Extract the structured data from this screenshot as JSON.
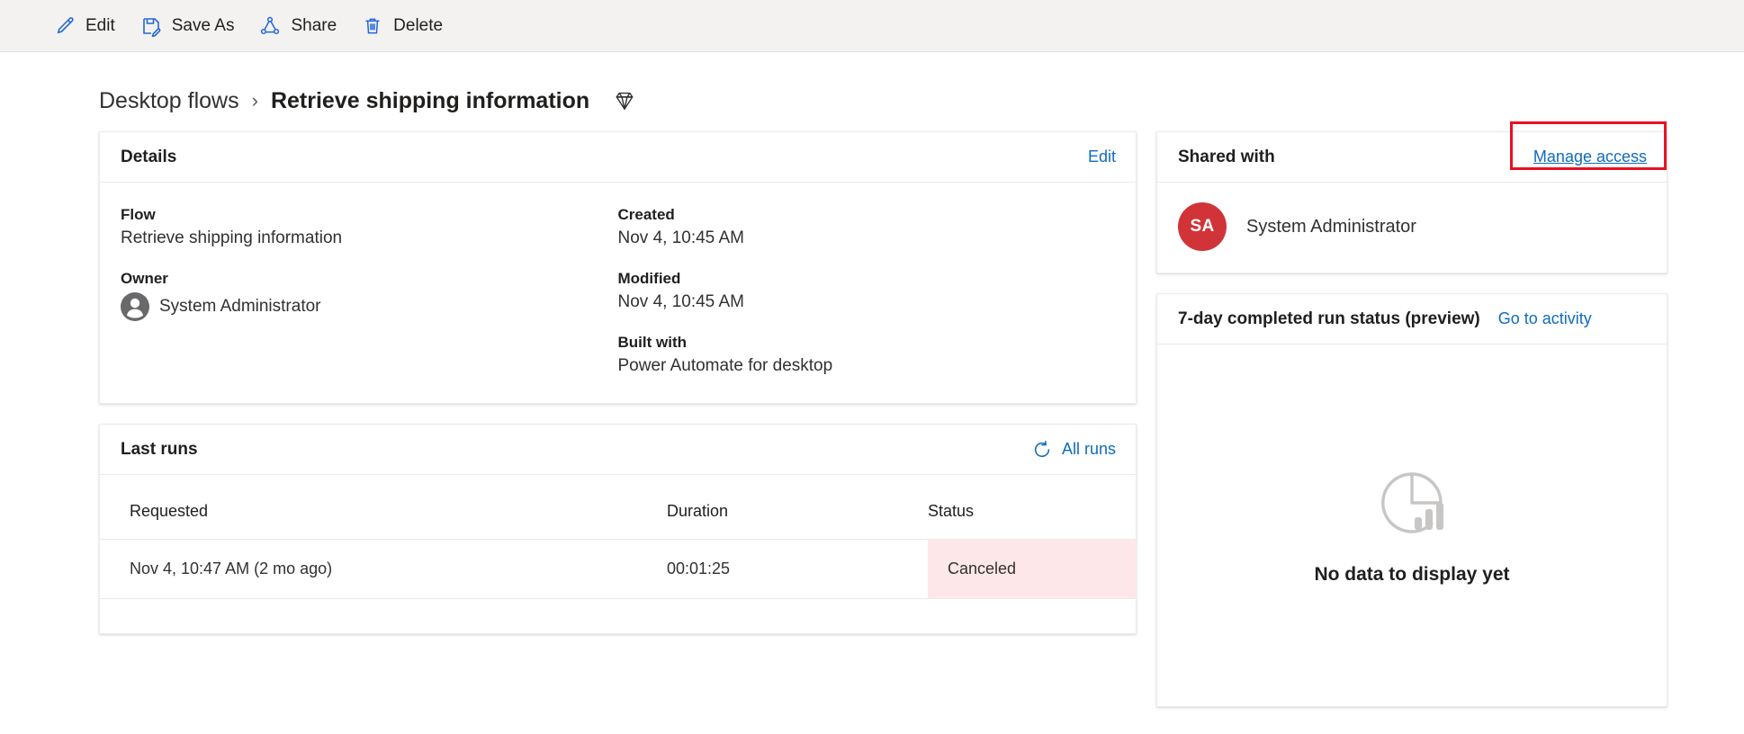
{
  "commandbar": {
    "buttons": [
      {
        "label": "Edit",
        "icon": "pencil-icon"
      },
      {
        "label": "Save As",
        "icon": "save-as-icon"
      },
      {
        "label": "Share",
        "icon": "share-icon"
      },
      {
        "label": "Delete",
        "icon": "trash-icon"
      }
    ]
  },
  "breadcrumb": {
    "parent": "Desktop flows",
    "separator": "›",
    "current": "Retrieve shipping information",
    "premium_icon": "premium-diamond-icon"
  },
  "details": {
    "title": "Details",
    "edit_label": "Edit",
    "left": [
      {
        "label": "Flow",
        "value": "Retrieve shipping information"
      },
      {
        "label": "Owner",
        "value": "System Administrator",
        "icon": "person-avatar-icon"
      }
    ],
    "right": [
      {
        "label": "Created",
        "value": "Nov 4, 10:45 AM"
      },
      {
        "label": "Modified",
        "value": "Nov 4, 10:45 AM"
      },
      {
        "label": "Built with",
        "value": "Power Automate for desktop"
      }
    ]
  },
  "last_runs": {
    "title": "Last runs",
    "all_runs_label": "All runs",
    "refresh_icon": "refresh-icon",
    "columns": [
      "Requested",
      "Duration",
      "Status"
    ],
    "rows": [
      {
        "requested": "Nov 4, 10:47 AM (2 mo ago)",
        "duration": "00:01:25",
        "status": "Canceled"
      }
    ]
  },
  "shared_with": {
    "title": "Shared with",
    "manage_access_label": "Manage access",
    "people": [
      {
        "initials": "SA",
        "name": "System Administrator",
        "avatar_color": "#d13438"
      }
    ]
  },
  "run_status": {
    "title": "7-day completed run status (preview)",
    "activity_link_label": "Go to activity",
    "empty_text": "No data to display yet",
    "empty_icon": "pie-bar-chart-icon"
  },
  "colors": {
    "accent_link": "#0f6cbd",
    "command_icon": "#2266dd",
    "highlight_border": "#e81123",
    "status_canceled_bg": "#fde7e9",
    "avatar_red": "#d13438",
    "commandbar_bg": "#f3f2f1"
  }
}
